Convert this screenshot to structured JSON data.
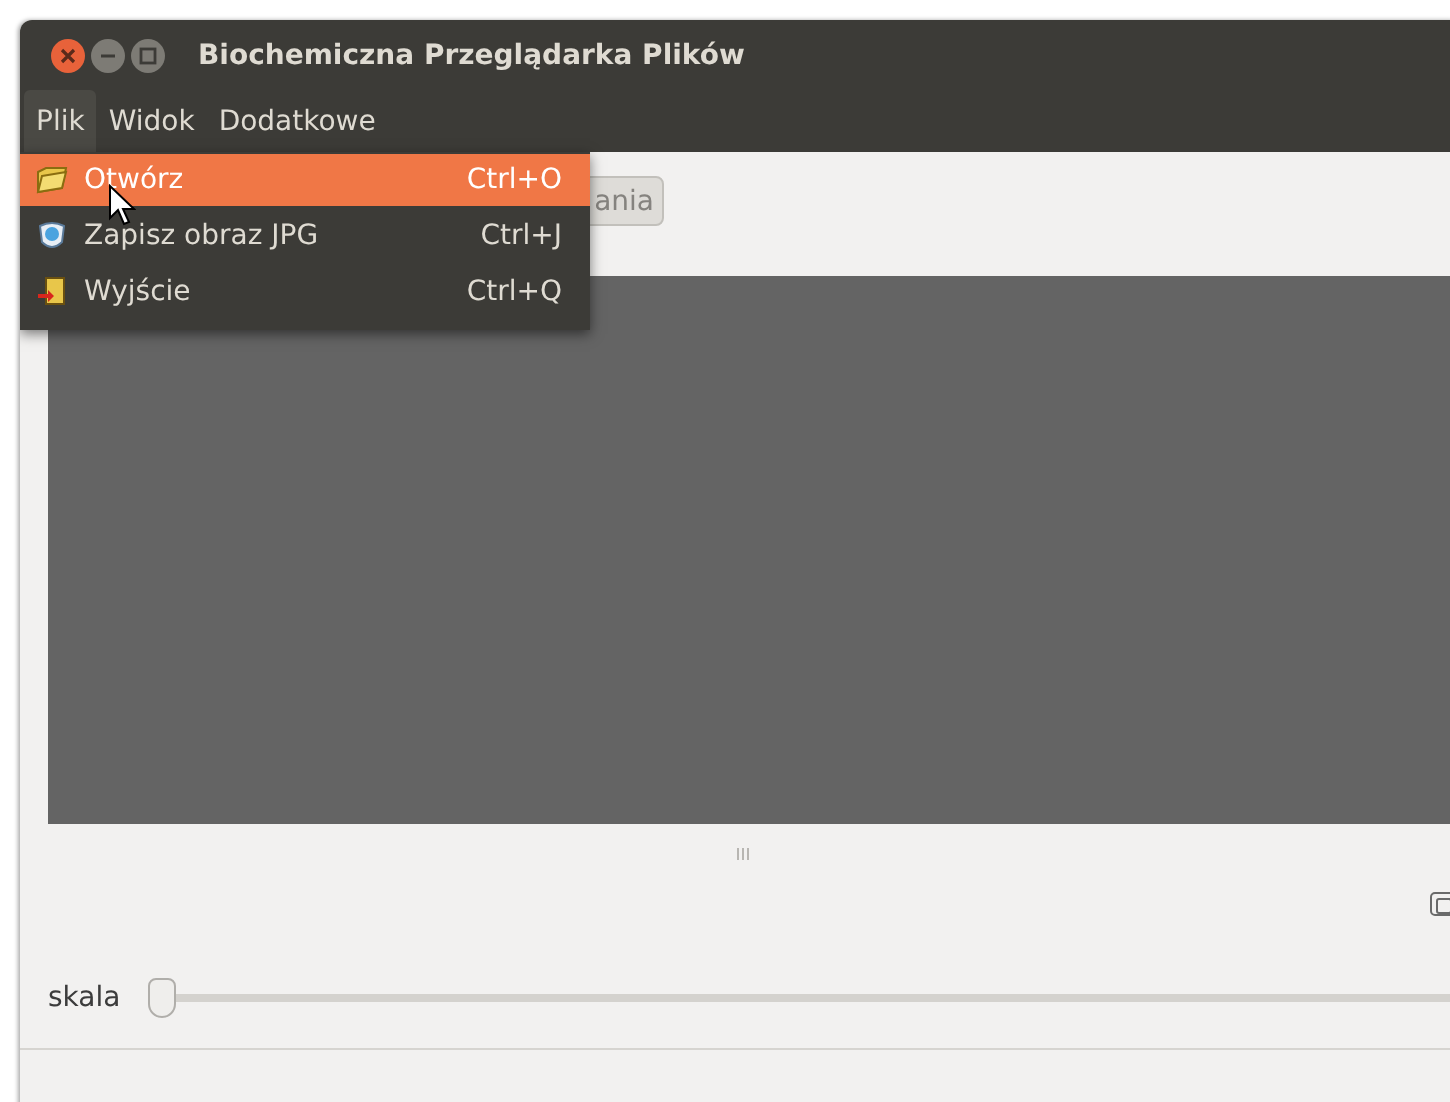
{
  "window": {
    "title": "Biochemiczna Przeglądarka Plików"
  },
  "menubar": [
    {
      "label": "Plik",
      "selected": true
    },
    {
      "label": "Widok",
      "selected": false
    },
    {
      "label": "Dodatkowe",
      "selected": false
    }
  ],
  "menu": {
    "items": [
      {
        "label": "Otwórz",
        "shortcut": "Ctrl+O",
        "selected": true
      },
      {
        "label": "Zapisz obraz JPG",
        "shortcut": "Ctrl+J",
        "selected": false
      },
      {
        "label": "Wyjście",
        "shortcut": "Ctrl+Q",
        "selected": false
      }
    ]
  },
  "toolbar": {
    "button": "ania"
  },
  "slider": {
    "label": "skala",
    "level": 0
  }
}
